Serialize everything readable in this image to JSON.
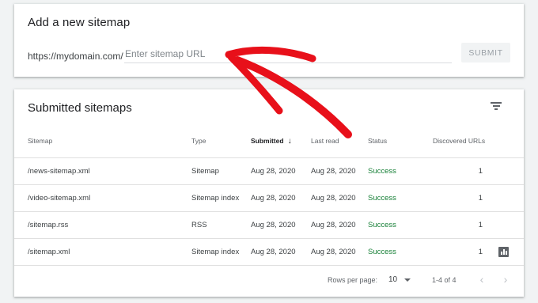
{
  "add_sitemap": {
    "title": "Add a new sitemap",
    "domain_prefix": "https://mydomain.com/",
    "input_placeholder": "Enter sitemap URL",
    "submit_label": "SUBMIT"
  },
  "submitted": {
    "title": "Submitted sitemaps",
    "filter_icon": "filter-list-icon",
    "columns": {
      "sitemap": "Sitemap",
      "type": "Type",
      "submitted": "Submitted",
      "last_read": "Last read",
      "status": "Status",
      "discovered": "Discovered URLs"
    },
    "sort_icon": "↓",
    "rows": [
      {
        "sitemap": "/news-sitemap.xml",
        "type": "Sitemap",
        "submitted": "Aug 28, 2020",
        "last_read": "Aug 28, 2020",
        "status": "Success",
        "discovered": "1"
      },
      {
        "sitemap": "/video-sitemap.xml",
        "type": "Sitemap index",
        "submitted": "Aug 28, 2020",
        "last_read": "Aug 28, 2020",
        "status": "Success",
        "discovered": "1"
      },
      {
        "sitemap": "/sitemap.rss",
        "type": "RSS",
        "submitted": "Aug 28, 2020",
        "last_read": "Aug 28, 2020",
        "status": "Success",
        "discovered": "1"
      },
      {
        "sitemap": "/sitemap.xml",
        "type": "Sitemap index",
        "submitted": "Aug 28, 2020",
        "last_read": "Aug 28, 2020",
        "status": "Success",
        "discovered": "1"
      }
    ],
    "footer": {
      "rows_per_page_label": "Rows per page:",
      "rows_per_page_value": "10",
      "range": "1-4 of 4",
      "prev_icon": "‹",
      "next_icon": "›"
    }
  },
  "colors": {
    "status_success": "#188038",
    "annotation_arrow": "#e8101a"
  }
}
